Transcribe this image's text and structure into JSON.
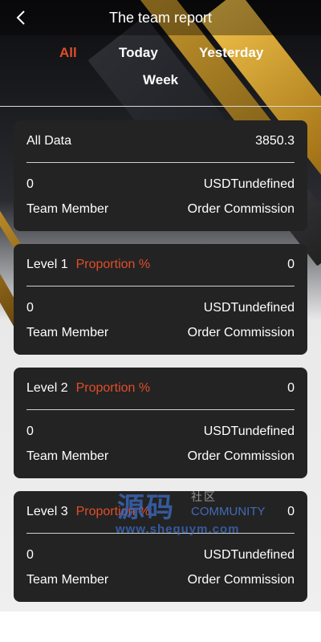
{
  "header": {
    "title": "The team report"
  },
  "tabs": [
    {
      "label": "All",
      "active": true
    },
    {
      "label": "Today",
      "active": false
    },
    {
      "label": "Yesterday",
      "active": false
    },
    {
      "label": "Week",
      "active": false
    }
  ],
  "colors": {
    "accent": "#e24d2a",
    "card_bg": "#232323"
  },
  "summary": {
    "label": "All Data",
    "value": "3850.3",
    "left_value": "0",
    "right_value": "USDTundefined",
    "left_label": "Team Member",
    "right_label": "Order Commission"
  },
  "levels": [
    {
      "label": "Level 1",
      "proportion_label": "Proportion %",
      "value": "0",
      "left_value": "0",
      "right_value": "USDTundefined",
      "left_label": "Team Member",
      "right_label": "Order Commission"
    },
    {
      "label": "Level 2",
      "proportion_label": "Proportion %",
      "value": "0",
      "left_value": "0",
      "right_value": "USDTundefined",
      "left_label": "Team Member",
      "right_label": "Order Commission"
    },
    {
      "label": "Level 3",
      "proportion_label": "Proportion %",
      "value": "0",
      "left_value": "0",
      "right_value": "USDTundefined",
      "left_label": "Team Member",
      "right_label": "Order Commission"
    }
  ],
  "watermark": {
    "main": "源码",
    "small": "社区",
    "community": "COMMUNITY",
    "url": "www.shequym.com"
  }
}
